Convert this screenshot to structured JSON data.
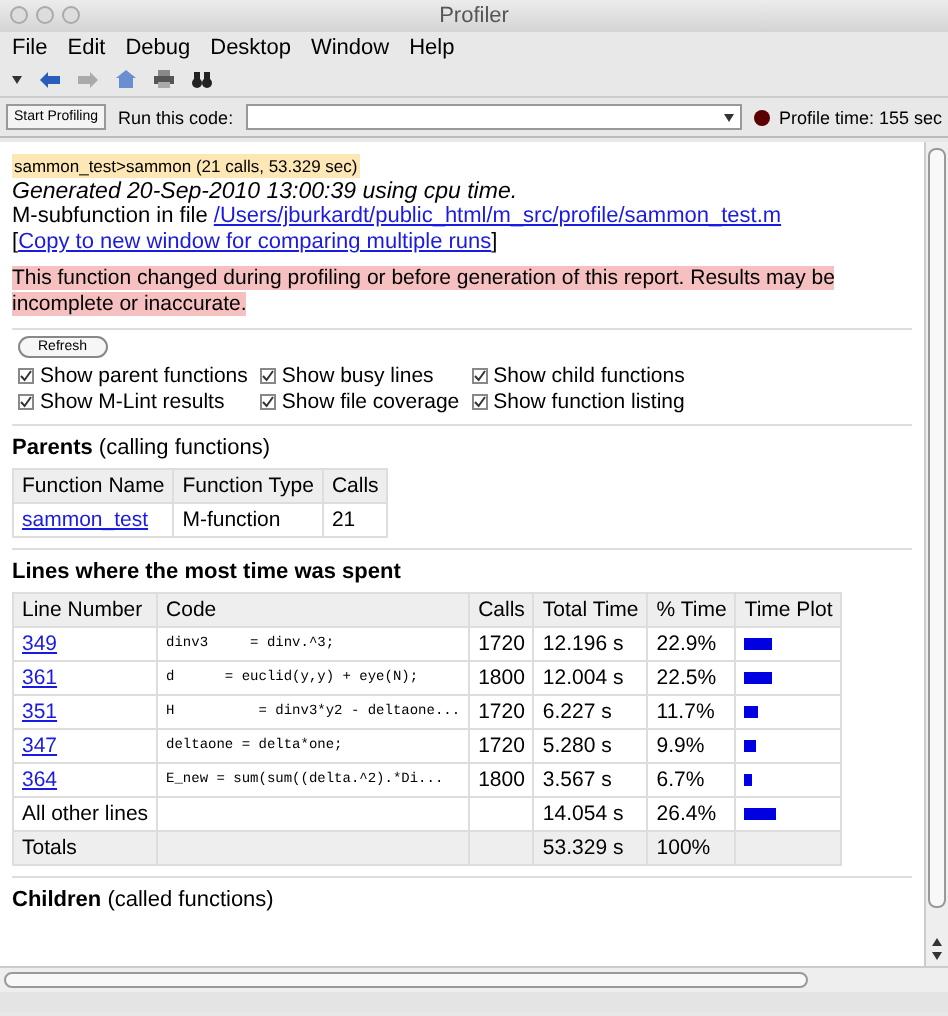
{
  "window": {
    "title": "Profiler"
  },
  "menu": [
    "File",
    "Edit",
    "Debug",
    "Desktop",
    "Window",
    "Help"
  ],
  "run_bar": {
    "button": "Start Profiling",
    "label": "Run this code:",
    "time": "Profile time: 155 sec"
  },
  "report": {
    "breadcrumb": "sammon_test>sammon (21 calls, 53.329 sec)",
    "generated": "Generated 20-Sep-2010 13:00:39 using cpu time.",
    "file_label": "M-subfunction in file",
    "file_link": "/Users/jburkardt/public_html/m_src/profile/sammon_test.m",
    "copy_open": "[",
    "copy_link": "Copy to new window for comparing multiple runs",
    "copy_close": "]",
    "warning": "This function changed during profiling or before generation of this report. Results may be incomplete or inaccurate.",
    "refresh": "Refresh"
  },
  "options": [
    {
      "label": "Show parent functions",
      "checked": true
    },
    {
      "label": "Show busy lines",
      "checked": true
    },
    {
      "label": "Show child functions",
      "checked": true
    },
    {
      "label": "Show M-Lint results",
      "checked": true
    },
    {
      "label": "Show file coverage",
      "checked": true
    },
    {
      "label": "Show function listing",
      "checked": true
    }
  ],
  "parents": {
    "title": "Parents",
    "subtitle": "(calling functions)",
    "columns": [
      "Function Name",
      "Function Type",
      "Calls"
    ],
    "rows": [
      [
        "sammon_test",
        "M-function",
        "21"
      ]
    ]
  },
  "lines": {
    "title": "Lines where the most time was spent",
    "columns": [
      "Line Number",
      "Code",
      "Calls",
      "Total Time",
      "% Time",
      "Time Plot"
    ],
    "rows": [
      {
        "line": "349",
        "code": "dinv3     = dinv.^3;",
        "calls": "1720",
        "total": "12.196 s",
        "pct": "22.9%",
        "level": 0.229
      },
      {
        "line": "361",
        "code": "d      = euclid(y,y) + eye(N);",
        "calls": "1800",
        "total": "12.004 s",
        "pct": "22.5%",
        "level": 0.225
      },
      {
        "line": "351",
        "code": "H          = dinv3*y2 - deltaone...",
        "calls": "1720",
        "total": "6.227 s",
        "pct": "11.7%",
        "level": 0.117
      },
      {
        "line": "347",
        "code": "deltaone = delta*one;",
        "calls": "1720",
        "total": "5.280 s",
        "pct": "9.9%",
        "level": 0.099
      },
      {
        "line": "364",
        "code": "E_new = sum(sum((delta.^2).*Di...",
        "calls": "1800",
        "total": "3.567 s",
        "pct": "6.7%",
        "level": 0.067
      },
      {
        "line": "All other lines",
        "code": "",
        "calls": "",
        "total": "14.054 s",
        "pct": "26.4%",
        "level": 0.264
      }
    ],
    "totals": {
      "label": "Totals",
      "total": "53.329 s",
      "pct": "100%"
    }
  },
  "children": {
    "title": "Children",
    "subtitle": "(called functions)"
  }
}
